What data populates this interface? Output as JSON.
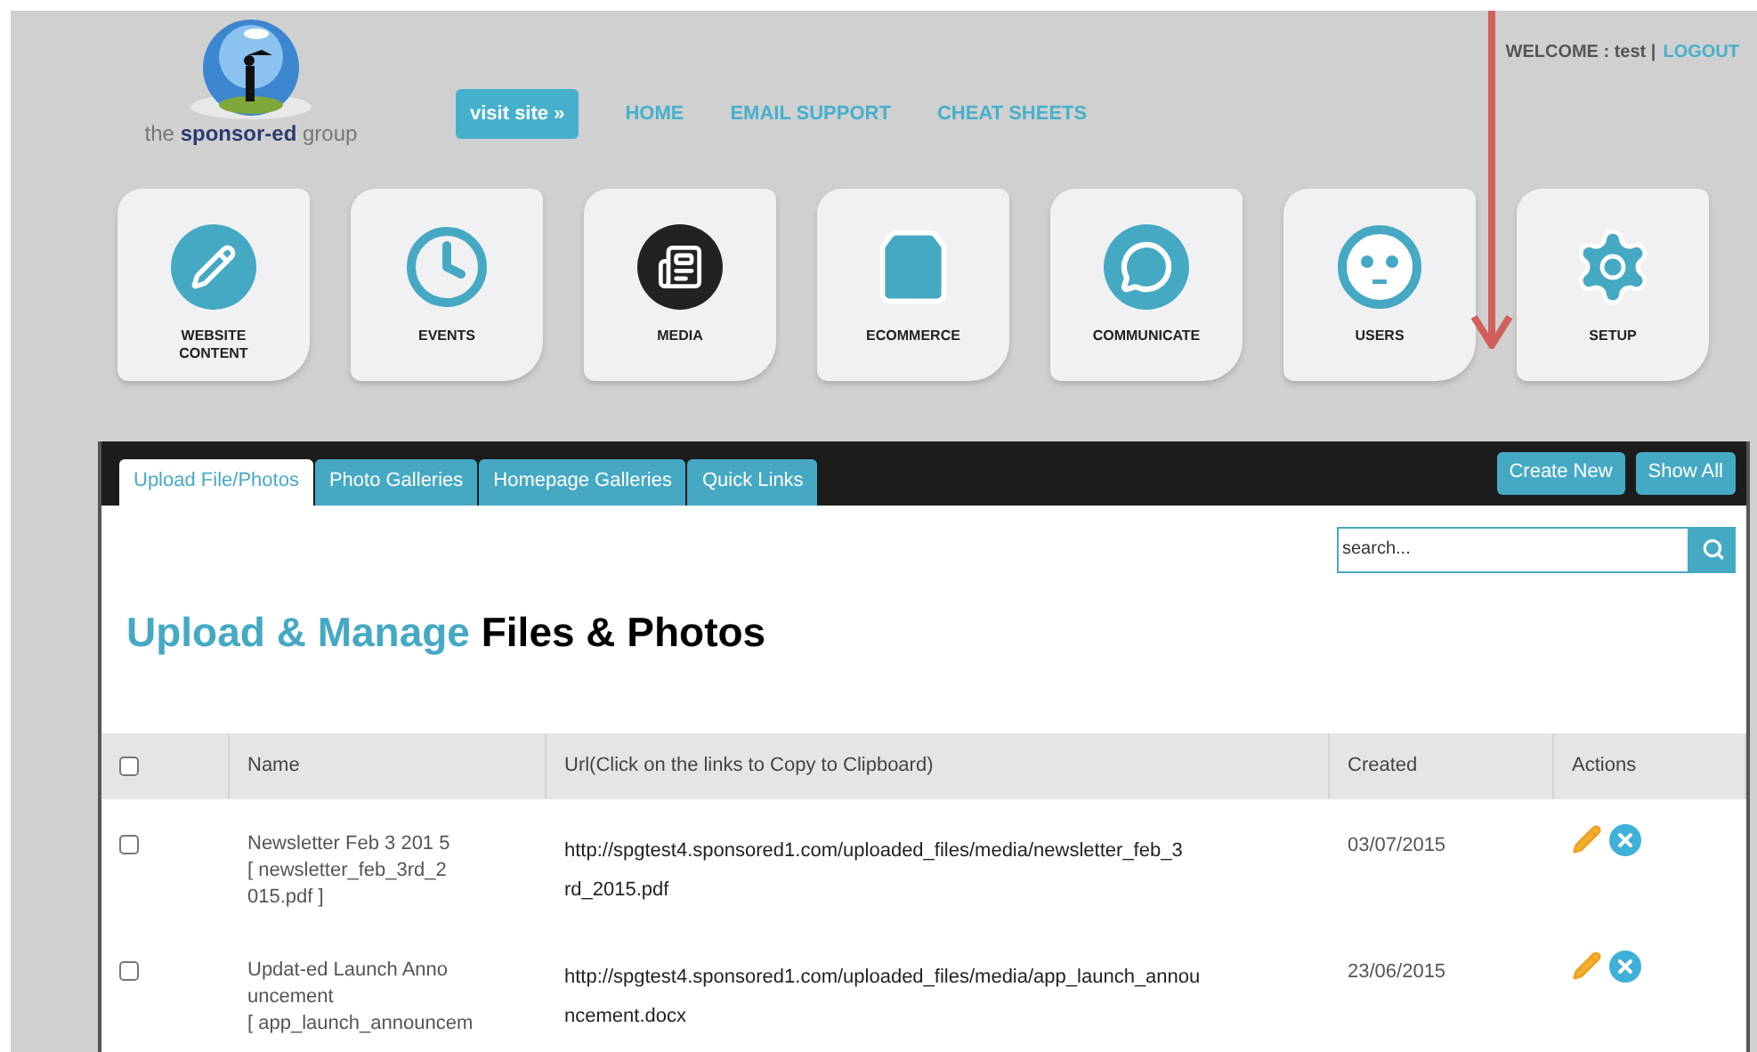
{
  "logo": {
    "text_parts": [
      "the",
      "sponsor-ed",
      "group"
    ]
  },
  "nav": {
    "visit_button": "visit site »",
    "links": [
      "HOME",
      "EMAIL SUPPORT",
      "CHEAT SHEETS"
    ]
  },
  "user_bar": {
    "welcome": "WELCOME : test |",
    "logout": "LOGOUT"
  },
  "modules": [
    {
      "kind": "pencil",
      "label": "WEBSITE CONTENT"
    },
    {
      "kind": "clock",
      "label": "EVENTS"
    },
    {
      "kind": "media",
      "label": "MEDIA"
    },
    {
      "kind": "bag",
      "label": "ECOMMERCE"
    },
    {
      "kind": "speech",
      "label": "COMMUNICATE"
    },
    {
      "kind": "face",
      "label": "USERS"
    },
    {
      "kind": "gear",
      "label": "SETUP"
    }
  ],
  "tabs": [
    {
      "label": "Upload File/Photos",
      "selected": true
    },
    {
      "label": "Photo Galleries",
      "selected": false
    },
    {
      "label": "Homepage Galleries",
      "selected": false
    },
    {
      "label": "Quick Links",
      "selected": false
    }
  ],
  "header_buttons": [
    "Create New",
    "Show All"
  ],
  "search": {
    "placeholder": "search..."
  },
  "heading": {
    "accent": "Upload & Manage",
    "rest": "Files & Photos"
  },
  "table": {
    "select_all_checked": false,
    "columns": [
      "Name",
      "Url(Click on the links to Copy to Clipboard)",
      "Created",
      "Actions"
    ],
    "rows": [
      {
        "checked": false,
        "name_lines": [
          "Newsletter Feb 3 201 5",
          "[ newsletter_feb_3rd_2",
          "015.pdf ]"
        ],
        "url_lines": [
          "http://spgtest4.sponsored1.com/uploaded_files/media/newsletter_feb_3",
          "rd_2015.pdf"
        ],
        "created": "03/07/2015"
      },
      {
        "checked": false,
        "name_lines": [
          "Updat-ed Launch Anno",
          "uncement",
          "[ app_launch_announcem"
        ],
        "url_lines": [
          "http://spgtest4.sponsored1.com/uploaded_files/media/app_launch_annou",
          "ncement.docx"
        ],
        "created": "23/06/2015"
      }
    ]
  }
}
